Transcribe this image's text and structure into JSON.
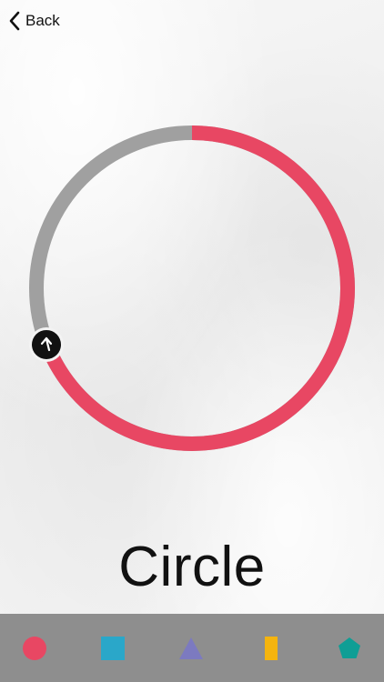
{
  "nav": {
    "back_label": "Back"
  },
  "main": {
    "shape_name": "Circle",
    "progress_fraction": 0.69,
    "colors": {
      "progress": "#e84763",
      "track": "#a0a0a0",
      "handle": "#111111"
    }
  },
  "tab_bar": {
    "background": "#8e8e8e",
    "items": [
      {
        "name": "circle",
        "icon": "circle-icon",
        "color": "#e84763"
      },
      {
        "name": "square",
        "icon": "square-icon",
        "color": "#2aa7c9"
      },
      {
        "name": "triangle",
        "icon": "triangle-icon",
        "color": "#7c7ac0"
      },
      {
        "name": "rectangle",
        "icon": "rectangle-icon",
        "color": "#f5b40e"
      },
      {
        "name": "pentagon",
        "icon": "pentagon-icon",
        "color": "#0f9e95"
      }
    ]
  }
}
